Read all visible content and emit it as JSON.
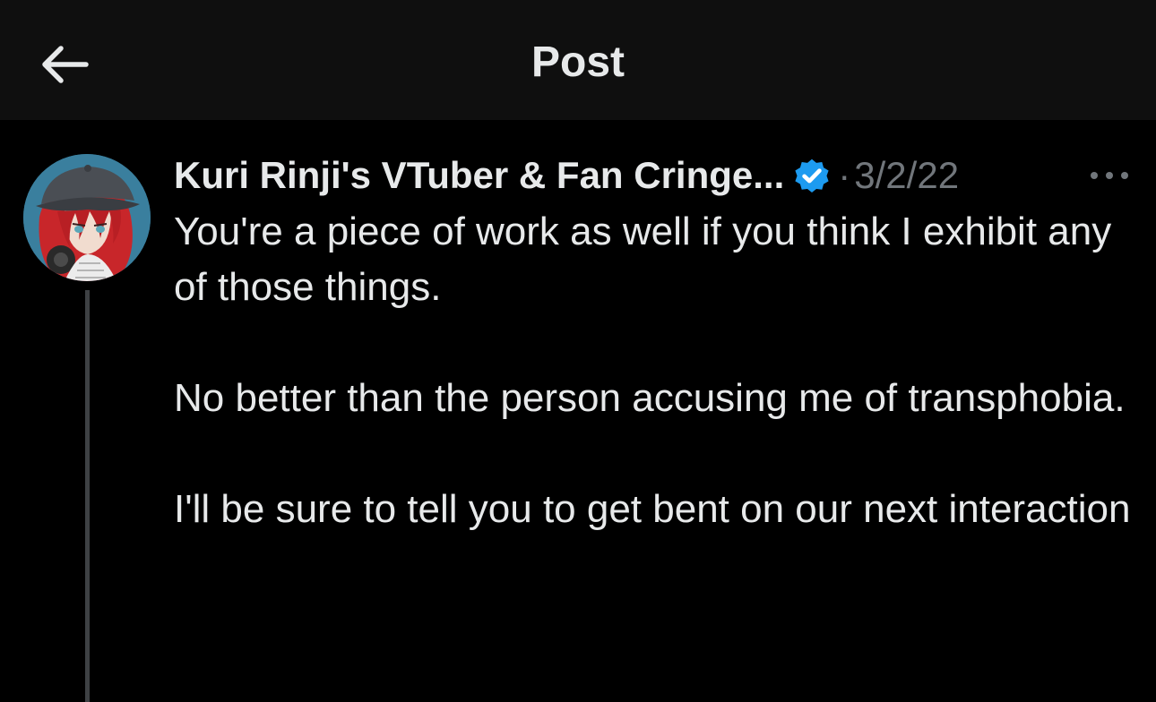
{
  "header": {
    "title": "Post",
    "back_icon": "arrow-left-icon"
  },
  "post": {
    "author": {
      "display_name": "Kuri Rinji's VTuber & Fan Cringe...",
      "verified": true,
      "verified_icon": "verified-badge-icon",
      "avatar": "avatar-image"
    },
    "separator": "·",
    "timestamp": "3/2/22",
    "more_icon": "more-options-icon",
    "paragraphs": [
      "You're a piece of work as well if you think I exhibit any of those things.",
      "No better than the person accusing me of transphobia.",
      "I'll be sure to tell you to get bent on our next interaction"
    ]
  },
  "colors": {
    "background": "#000000",
    "topbar": "#0f0f0f",
    "text_primary": "#e7e9ea",
    "text_secondary": "#71767b",
    "verified_blue": "#1d9bf0",
    "thread_line": "#3e4144"
  }
}
